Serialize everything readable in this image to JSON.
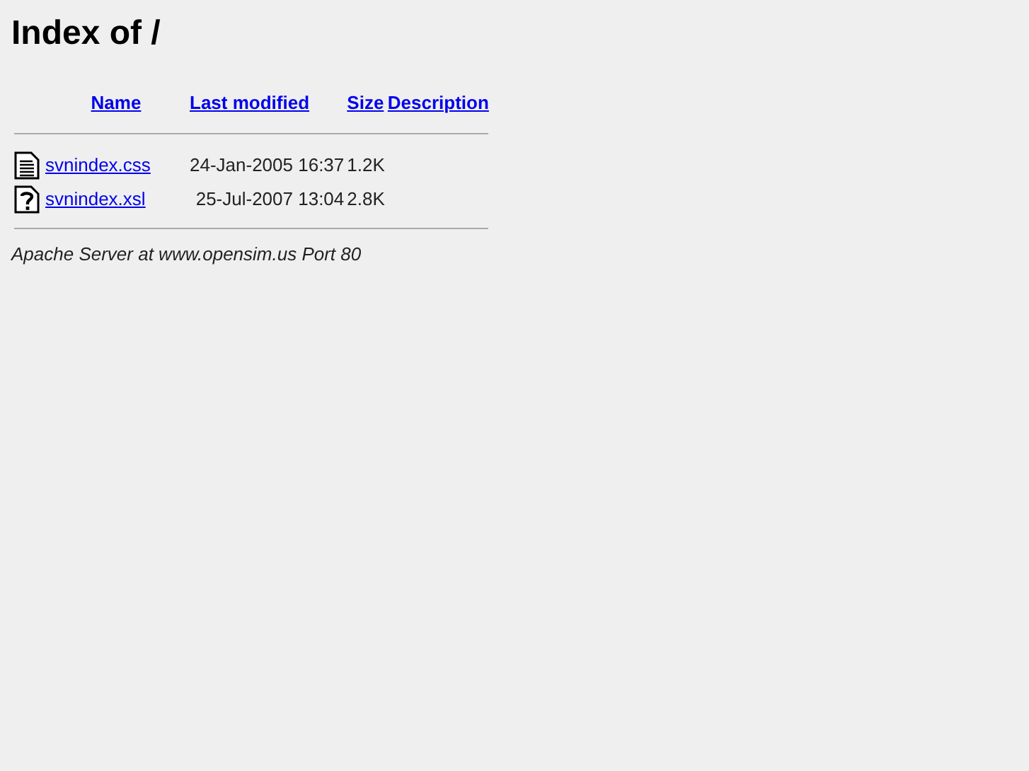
{
  "title": "Index of /",
  "columns": [
    "Name",
    "Last modified",
    "Size",
    "Description"
  ],
  "rows": [
    {
      "kind": "text",
      "name": "svnindex.css",
      "modified": "24-Jan-2005 16:37",
      "size": "1.2K"
    },
    {
      "kind": "unknown",
      "name": "svnindex.xsl",
      "modified": "25-Jul-2007 13:04",
      "size": "2.8K"
    }
  ],
  "footer": "Apache Server at www.opensim.us Port 80"
}
